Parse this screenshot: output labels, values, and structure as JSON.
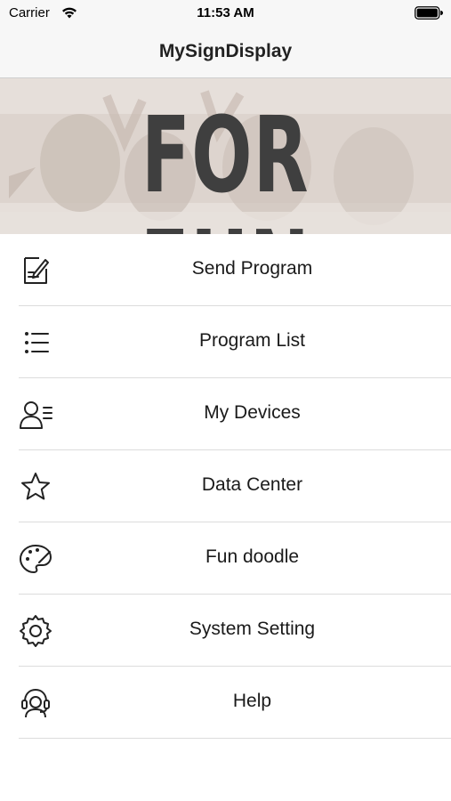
{
  "status_bar": {
    "carrier": "Carrier",
    "time": "11:53 AM",
    "wifi_icon": "wifi-icon",
    "battery_icon": "battery-icon"
  },
  "nav": {
    "title": "MySignDisplay"
  },
  "banner": {
    "text": "FOR FUN"
  },
  "menu": {
    "items": [
      {
        "label": "Send Program",
        "icon": "edit-note-icon"
      },
      {
        "label": "Program List",
        "icon": "bullet-list-icon"
      },
      {
        "label": "My Devices",
        "icon": "user-list-icon"
      },
      {
        "label": "Data Center",
        "icon": "star-icon"
      },
      {
        "label": "Fun doodle",
        "icon": "palette-icon"
      },
      {
        "label": "System Setting",
        "icon": "gear-icon"
      },
      {
        "label": "Help",
        "icon": "headset-support-icon"
      }
    ]
  },
  "colors": {
    "bar_background": "#f7f7f7",
    "separator": "#dcdcdc",
    "banner_text": "#3f3f3f"
  }
}
